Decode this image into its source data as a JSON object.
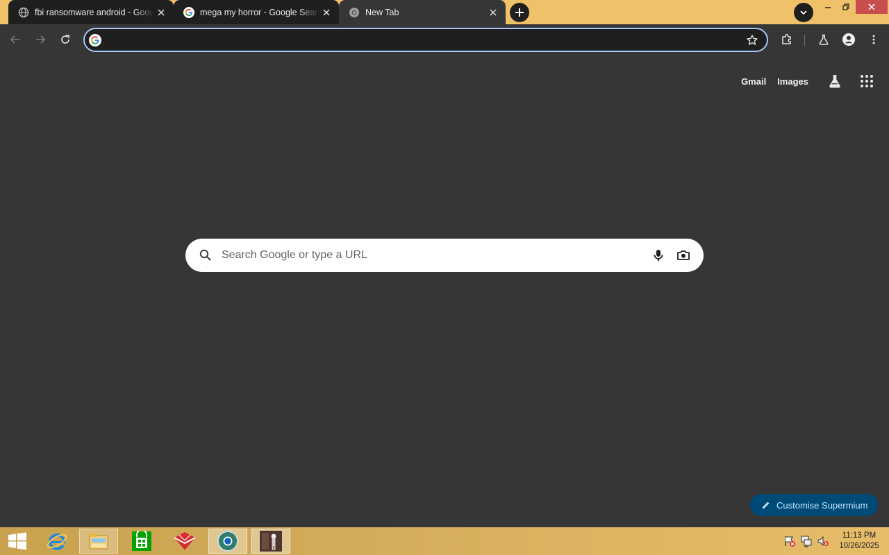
{
  "tabs": [
    {
      "title": "fbi ransomware android - Google Search",
      "favicon": "globe-icon",
      "state": "inactive"
    },
    {
      "title": "mega my horror - Google Search",
      "favicon": "google-g-icon",
      "state": "inactive"
    },
    {
      "title": "New Tab",
      "favicon": "chromium-icon",
      "state": "active"
    }
  ],
  "toolbar": {
    "omnibox_value": "",
    "icons": [
      "back-icon",
      "forward-icon",
      "reload-icon",
      "google-g-icon",
      "bookmark-star-icon",
      "extensions-icon",
      "labs-icon",
      "profile-icon",
      "menu-icon"
    ]
  },
  "page": {
    "links": {
      "gmail": "Gmail",
      "images": "Images"
    },
    "search_placeholder": "Search Google or type a URL",
    "customise_label": "Customise Supermium"
  },
  "taskbar": {
    "items": [
      "windows-start-icon",
      "internet-explorer-icon",
      "file-explorer-icon",
      "windows-store-icon",
      "app-icon",
      "chromium-browser-icon",
      "photo-app-icon"
    ],
    "clock_time": "11:13 PM",
    "clock_date": "10/26/2025"
  },
  "colors": {
    "titlebar": "#efc26a",
    "page_bg": "#363636",
    "omnibox_focus": "#a8c7fa",
    "customise_bg": "#004a77",
    "close_red": "#c94f4f"
  }
}
